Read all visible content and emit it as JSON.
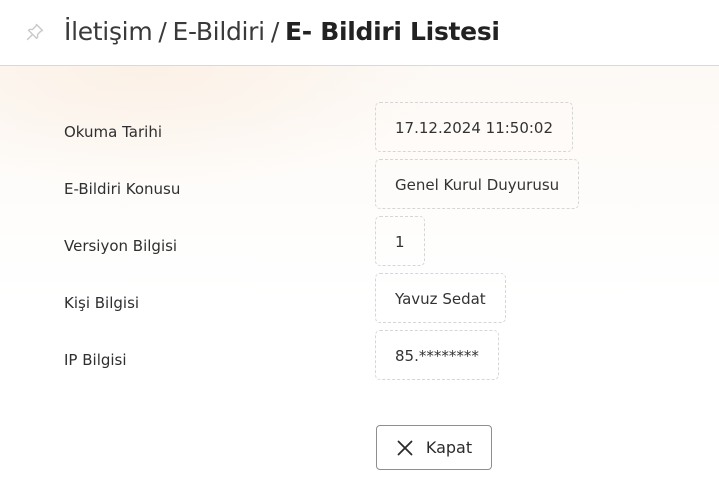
{
  "header": {
    "breadcrumb": [
      "İletişim",
      "E-Bildiri"
    ],
    "separator": "/",
    "current": "E- Bildiri Listesi",
    "pin_icon": "pin-icon"
  },
  "details": [
    {
      "label": "Okuma Tarihi",
      "value": "17.12.2024 11:50:02"
    },
    {
      "label": "E-Bildiri Konusu",
      "value": "Genel Kurul Duyurusu"
    },
    {
      "label": "Versiyon Bilgisi",
      "value": "1"
    },
    {
      "label": "Kişi Bilgisi",
      "value": "Yavuz Sedat"
    },
    {
      "label": "IP Bilgisi",
      "value": "85.********"
    }
  ],
  "actions": {
    "close_label": "Kapat",
    "close_icon": "close-icon"
  }
}
